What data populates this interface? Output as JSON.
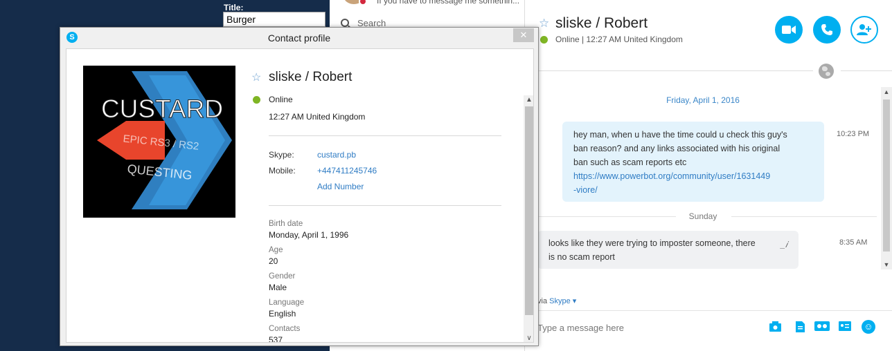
{
  "background": {
    "title_label": "Title:",
    "title_value": "Burger"
  },
  "recent": {
    "snippet": "If you have to message me somethin...",
    "search_placeholder": "Search"
  },
  "conversation": {
    "name": "sliske /  Robert",
    "status": "Online  |  12:27 AM United Kingdom",
    "day1": "Friday, April 1, 2016",
    "message1_lines": [
      "hey man, when u have the time could u check this guy's",
      "ban reason? and any links associated with his original",
      "ban such as scam reports etc"
    ],
    "message1_link_lines": [
      "https://www.powerbot.org/community/user/1631449",
      "-viore/"
    ],
    "message1_time": "10:23 PM",
    "day2": "Sunday",
    "message2_lines": [
      "looks like they were trying to imposter someone, there",
      "is no scam report"
    ],
    "message2_time": "8:35 AM",
    "via_prefix": "via",
    "via_service": "Skype",
    "compose_placeholder": "Type a message here"
  },
  "profile": {
    "window_title": "Contact profile",
    "close_label": "✕",
    "name": "sliske /  Robert",
    "status": "Online",
    "local_time": "12:27 AM United Kingdom",
    "skype_label": "Skype:",
    "skype_value": "custard.pb",
    "mobile_label": "Mobile:",
    "mobile_value": "+447411245746",
    "add_number": "Add Number",
    "avatar_text": {
      "line1": "CUSTARD",
      "line2": "EPIC RS3 / RS2",
      "line3": "QUESTING"
    },
    "fields": [
      {
        "label": "Birth date",
        "value": "Monday, April 1, 1996"
      },
      {
        "label": "Age",
        "value": "20"
      },
      {
        "label": "Gender",
        "value": "Male"
      },
      {
        "label": "Language",
        "value": "English"
      },
      {
        "label": "Contacts",
        "value": "537"
      }
    ]
  },
  "colors": {
    "accent": "#00aff0",
    "online": "#7fb524",
    "link": "#2f7cc4"
  }
}
